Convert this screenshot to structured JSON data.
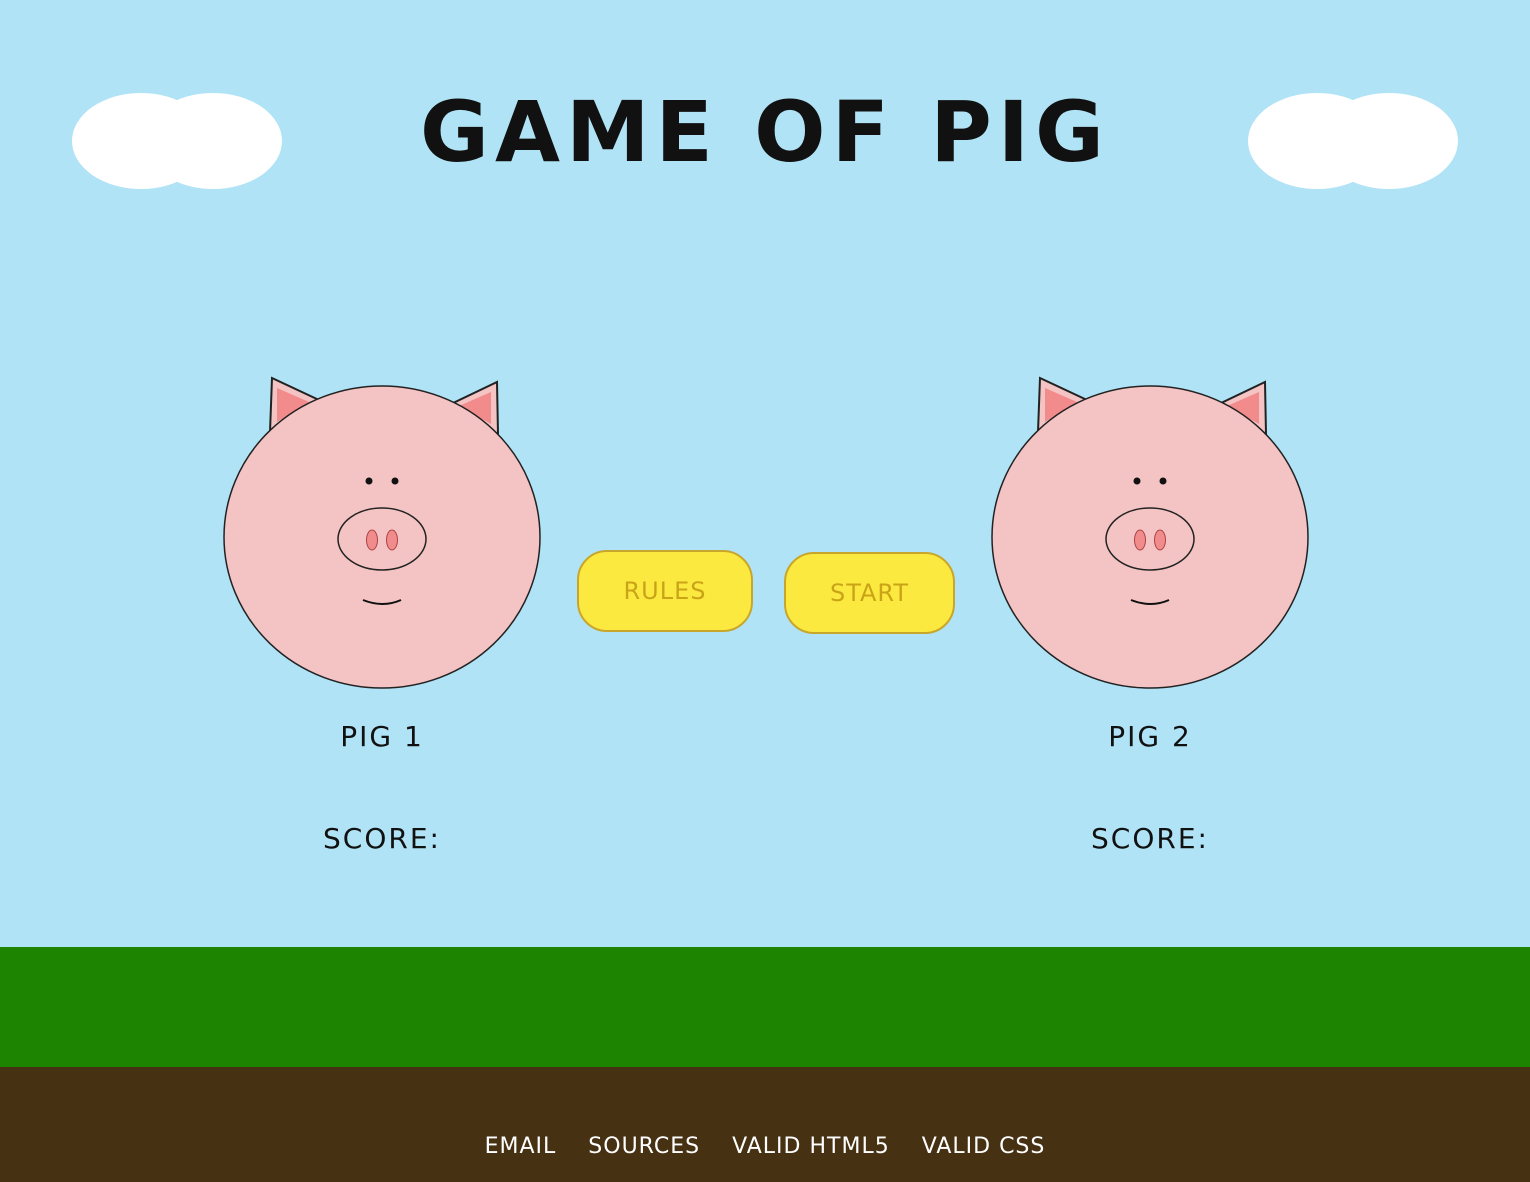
{
  "title": "GAME OF PIG",
  "players": [
    {
      "name": "PIG 1",
      "score_label": "SCORE:"
    },
    {
      "name": "PIG 2",
      "score_label": "SCORE:"
    }
  ],
  "buttons": {
    "rules": "RULES",
    "start": "START"
  },
  "footer": {
    "links": [
      "EMAIL",
      "SOURCES",
      "VALID HTML5",
      "VALID CSS"
    ]
  },
  "colors": {
    "sky": "#b0e3f5",
    "grass": "#1c8400",
    "dirt": "#473113",
    "pig_skin": "#f4c3c3",
    "pig_inner_ear": "#f28b8b",
    "button_fill": "#fce940",
    "button_text": "#c9a417"
  }
}
